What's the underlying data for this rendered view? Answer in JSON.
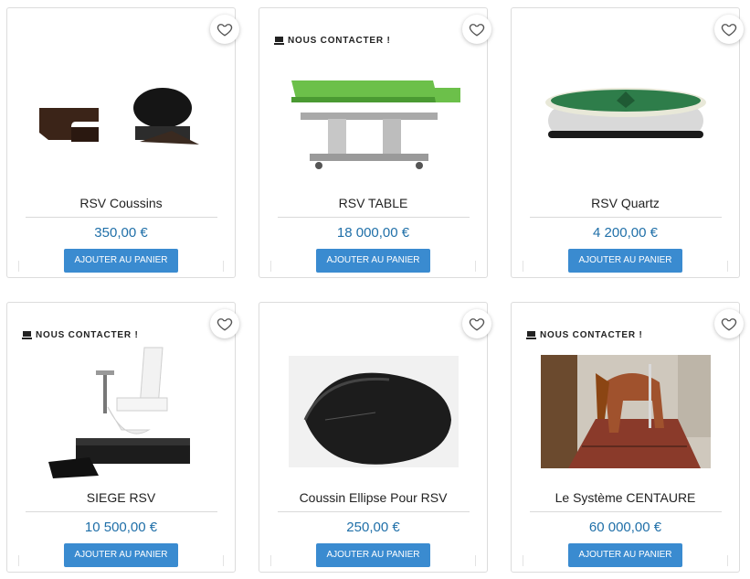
{
  "products": [
    {
      "name": "RSV Coussins",
      "price": "350,00 €",
      "button": "AJOUTER AU PANIER",
      "flag": ""
    },
    {
      "name": "RSV TABLE",
      "price": "18 000,00 €",
      "button": "AJOUTER AU PANIER",
      "flag": "NOUS CONTACTER !"
    },
    {
      "name": "RSV Quartz",
      "price": "4 200,00 €",
      "button": "AJOUTER AU PANIER",
      "flag": ""
    },
    {
      "name": "SIEGE RSV",
      "price": "10 500,00 €",
      "button": "AJOUTER AU PANIER",
      "flag": "NOUS CONTACTER !"
    },
    {
      "name": "Coussin Ellipse Pour RSV",
      "price": "250,00 €",
      "button": "AJOUTER AU PANIER",
      "flag": ""
    },
    {
      "name": "Le Système CENTAURE",
      "price": "60 000,00 €",
      "button": "AJOUTER AU PANIER",
      "flag": "NOUS CONTACTER !"
    }
  ],
  "icons": {
    "favorite": "heart-outline-icon",
    "flag": "laptop-icon"
  },
  "colors": {
    "price": "#1f6fa8",
    "button": "#3a8bd0",
    "green_top": "#6cc04a"
  }
}
